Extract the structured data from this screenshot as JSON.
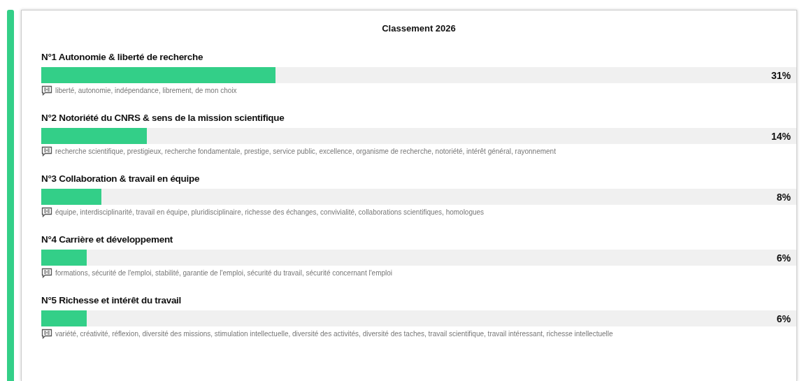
{
  "title": "Classement 2026",
  "items": [
    {
      "rank": "N°1 Autonomie & liberté de recherche",
      "level": 0.31,
      "reading": "31%",
      "keywords": "liberté, autonomie, indépendance, librement, de mon choix"
    },
    {
      "rank": "N°2 Notoriété du CNRS & sens de la mission scientifique",
      "level": 0.14,
      "reading": "14%",
      "keywords": "recherche scientifique, prestigieux, recherche fondamentale, prestige, service public, excellence, organisme de recherche, notoriété, intérêt général, rayonnement"
    },
    {
      "rank": "N°3 Collaboration & travail en équipe",
      "level": 0.08,
      "reading": "8%",
      "keywords": "équipe, interdisciplinarité, travail en équipe, pluridisciplinaire, richesse des échanges, convivialité, collaborations scientifiques, homologues"
    },
    {
      "rank": "N°4 Carrière et développement",
      "level": 0.06,
      "reading": "6%",
      "keywords": "formations, sécurité de l'emploi, stabilité, garantie de l'emploi, sécurité du travail, sécurité concernant l'emploi"
    },
    {
      "rank": "N°5 Richesse et intérêt du travail",
      "level": 0.06,
      "reading": "6%",
      "keywords": "variété, créativité, réflexion, diversité des missions, stimulation intellectuelle, diversité des activités, diversité des taches, travail scientifique, travail intéressant, richesse intellectuelle"
    }
  ]
}
